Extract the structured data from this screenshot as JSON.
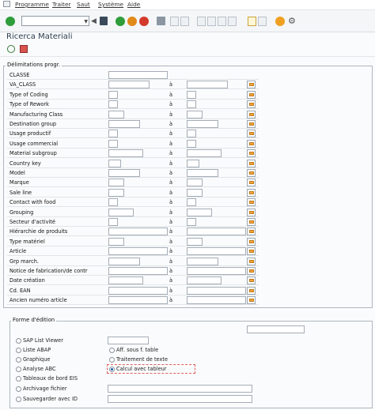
{
  "menu": [
    "Programme",
    "Traiter",
    "Saut",
    "Système",
    "Aide"
  ],
  "title": "Ricerca Materiali",
  "selection_group": "Délimitations progr.",
  "to_label": "à",
  "rows": [
    {
      "label": "CLASSE"
    },
    {
      "label": "VA_CLASS"
    },
    {
      "label": "Type of Coding"
    },
    {
      "label": "Type of Rework"
    },
    {
      "label": "Manufacturing Class"
    },
    {
      "label": "Destination group"
    },
    {
      "label": "Usage productif"
    },
    {
      "label": "Usage commercial"
    },
    {
      "label": "Material subgroup"
    },
    {
      "label": "Country key"
    },
    {
      "label": "Model"
    },
    {
      "label": "Marque"
    },
    {
      "label": "Sale line"
    },
    {
      "label": "Contact with food"
    },
    {
      "label": "Grouping"
    },
    {
      "label": "Secteur d'activité"
    },
    {
      "label": "Hiérarchie de produits"
    },
    {
      "label": "Type matériel"
    },
    {
      "label": "Article"
    },
    {
      "label": "Grp march."
    },
    {
      "label": "Notice de fabrication/de contr"
    },
    {
      "label": "Date création"
    },
    {
      "label": "Cd. EAN"
    },
    {
      "label": "Ancien numéro article"
    }
  ],
  "output_group": "Forme d'édition",
  "options": {
    "sap_list_viewer": "SAP List Viewer",
    "liste_abap": "Liste ABAP",
    "aff_sous_table": "Aff. sous f. table",
    "graphique": "Graphique",
    "traitement_texte": "Traitement de texte",
    "analyse_abc": "Analyse ABC",
    "calcul_tableur": "Calcul avec tableur",
    "tableaux_eis": "Tableaux de bord EIS",
    "archivage": "Archivage fichier",
    "sauvegarder": "Sauvegarder avec ID"
  },
  "colors": {
    "ok": "#2e9d3a",
    "back": "#e08a1a",
    "exit": "#d88a1a",
    "cancel": "#d33a2c",
    "help": "#f0a020"
  }
}
